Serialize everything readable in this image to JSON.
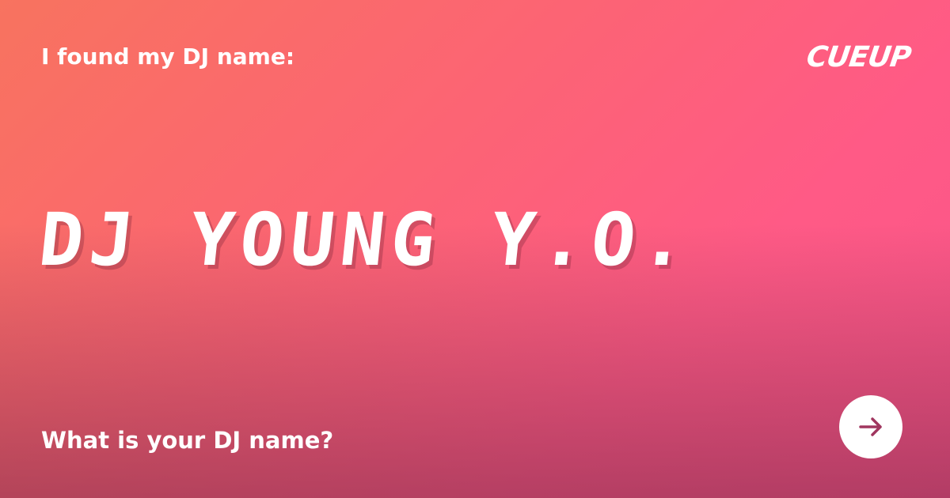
{
  "header": {
    "intro_text": "I found my DJ name:",
    "logo_text": "CUEUP"
  },
  "main": {
    "dj_name": "DJ YOUNG Y.O."
  },
  "footer": {
    "question_text": "What is your DJ name?",
    "next_icon": "arrow-right-icon"
  },
  "colors": {
    "background_start": "#f8735f",
    "background_end": "#ff5a86",
    "text": "#ffffff",
    "arrow": "#a0365f"
  }
}
